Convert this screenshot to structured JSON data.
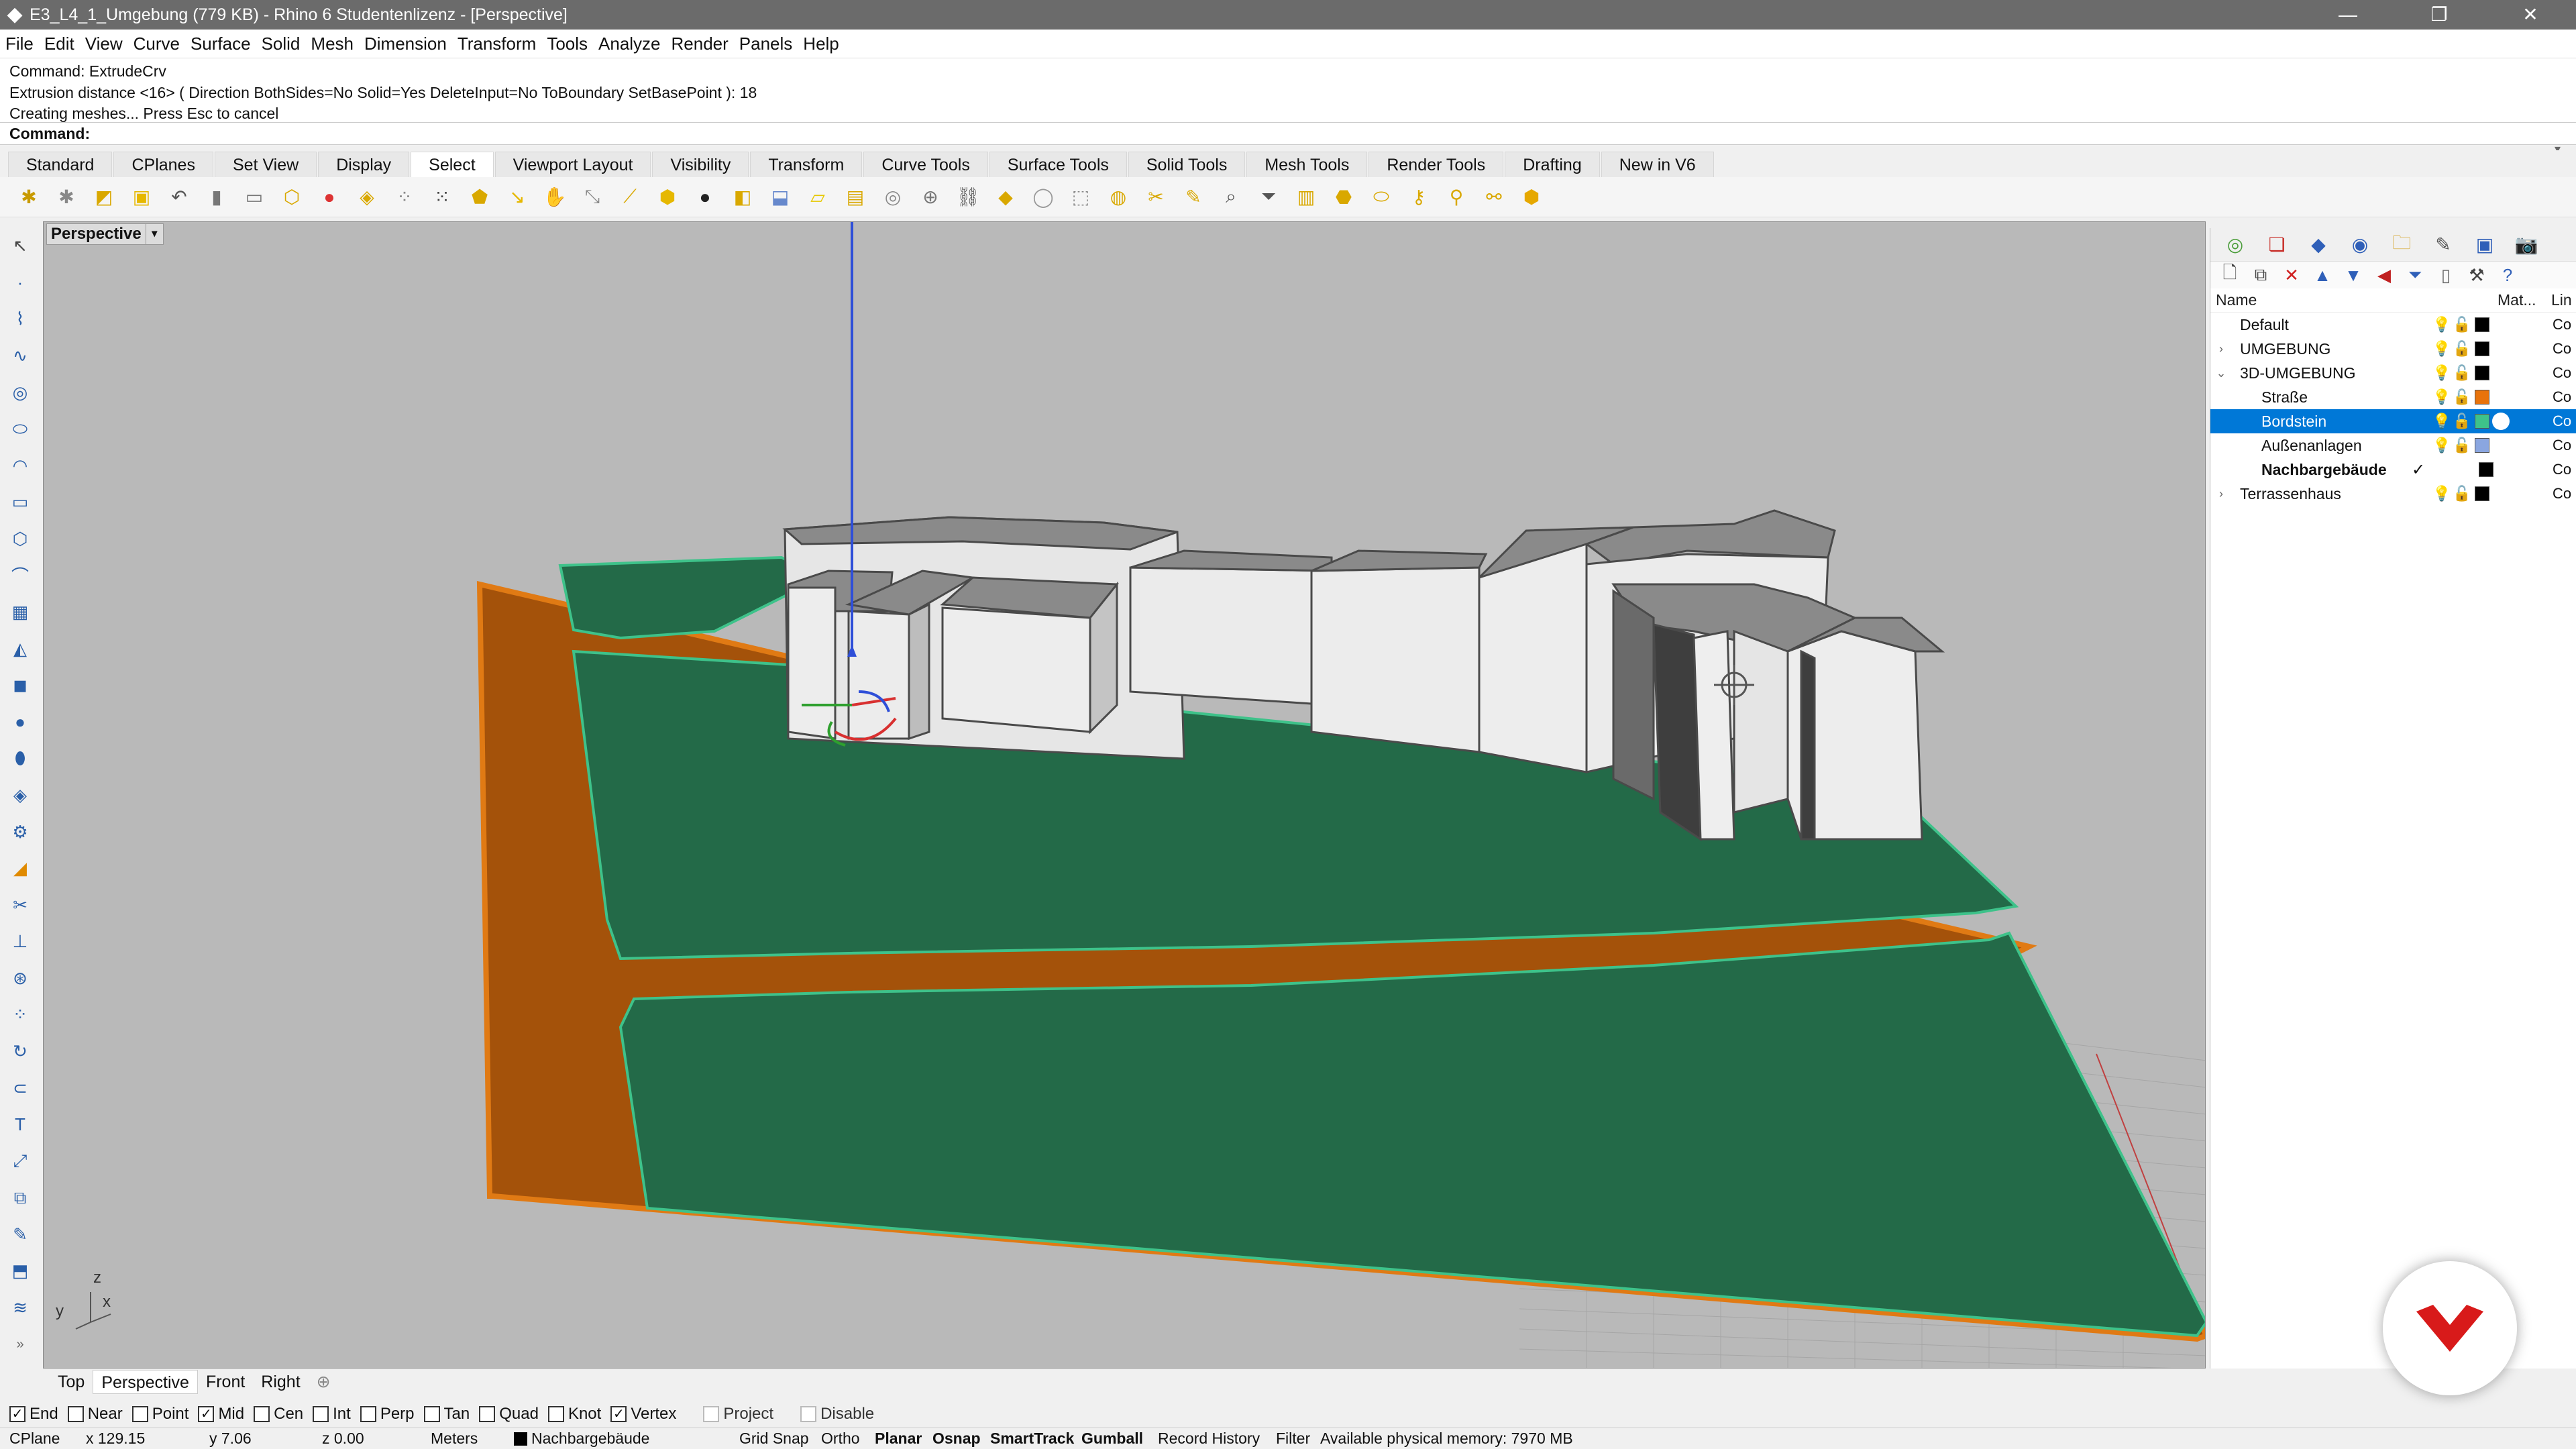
{
  "window": {
    "title": "E3_L4_1_Umgebung (779 KB) - Rhino 6 Studentenlizenz - [Perspective]"
  },
  "menu": [
    "File",
    "Edit",
    "View",
    "Curve",
    "Surface",
    "Solid",
    "Mesh",
    "Dimension",
    "Transform",
    "Tools",
    "Analyze",
    "Render",
    "Panels",
    "Help"
  ],
  "command_history": [
    "Command: ExtrudeCrv",
    "Extrusion distance <16> ( Direction  BothSides=No  Solid=Yes  DeleteInput=No  ToBoundary  SetBasePoint ): 18",
    "Creating meshes... Press Esc to cancel"
  ],
  "command_prompt": {
    "label": "Command:",
    "value": ""
  },
  "toolbar_tabs": [
    "Standard",
    "CPlanes",
    "Set View",
    "Display",
    "Select",
    "Viewport Layout",
    "Visibility",
    "Transform",
    "Curve Tools",
    "Surface Tools",
    "Solid Tools",
    "Mesh Tools",
    "Render Tools",
    "Drafting",
    "New in V6"
  ],
  "active_toolbar_tab": "Select",
  "viewport": {
    "label": "Perspective",
    "axes": {
      "z": "z",
      "y": "y",
      "x": "x"
    }
  },
  "layers_panel": {
    "headers": {
      "name": "Name",
      "material": "Mat...",
      "linetype": "Lin"
    },
    "rows": [
      {
        "name": "Default",
        "expand": "",
        "color": "#000000",
        "linetype": "Co"
      },
      {
        "name": "UMGEBUNG",
        "expand": "›",
        "color": "#000000",
        "linetype": "Co"
      },
      {
        "name": "3D-UMGEBUNG",
        "expand": "⌄",
        "color": "#000000",
        "linetype": "Co"
      },
      {
        "name": "Straße",
        "expand": "",
        "color": "#e8730c",
        "linetype": "Co"
      },
      {
        "name": "Bordstein",
        "expand": "",
        "color": "#3ec28a",
        "linetype": "Co",
        "selected": true
      },
      {
        "name": "Außenanlagen",
        "expand": "",
        "color": "#8aa6e0",
        "linetype": "Co"
      },
      {
        "name": "Nachbargebäude",
        "expand": "",
        "color": "#000000",
        "linetype": "Co",
        "current": true
      },
      {
        "name": "Terrassenhaus",
        "expand": "›",
        "color": "#000000",
        "linetype": "Co"
      }
    ]
  },
  "viewport_tabs": [
    "Top",
    "Perspective",
    "Front",
    "Right"
  ],
  "active_viewport_tab": "Perspective",
  "osnaps": [
    {
      "label": "End",
      "checked": true
    },
    {
      "label": "Near",
      "checked": false
    },
    {
      "label": "Point",
      "checked": false
    },
    {
      "label": "Mid",
      "checked": true
    },
    {
      "label": "Cen",
      "checked": false
    },
    {
      "label": "Int",
      "checked": false
    },
    {
      "label": "Perp",
      "checked": false
    },
    {
      "label": "Tan",
      "checked": false
    },
    {
      "label": "Quad",
      "checked": false
    },
    {
      "label": "Knot",
      "checked": false
    },
    {
      "label": "Vertex",
      "checked": true
    },
    {
      "label": "Project",
      "checked": false,
      "disabled": true
    },
    {
      "label": "Disable",
      "checked": false,
      "disabled": true
    }
  ],
  "status": {
    "cplane": "CPlane",
    "x": "x 129.15",
    "y": "y 7.06",
    "z": "z 0.00",
    "units": "Meters",
    "layer": "Nachbargebäude",
    "grid_snap": "Grid Snap",
    "ortho": "Ortho",
    "planar": "Planar",
    "osnap": "Osnap",
    "smarttrack": "SmartTrack",
    "gumball": "Gumball",
    "record_history": "Record History",
    "filter": "Filter",
    "memory": "Available physical memory: 7970 MB"
  },
  "colors": {
    "terrain_green": "#236a48",
    "road_orange": "#a4520a",
    "edge_green": "#3ec28a",
    "selection_blue": "#0078d7",
    "badge_red": "#d81a1a"
  }
}
